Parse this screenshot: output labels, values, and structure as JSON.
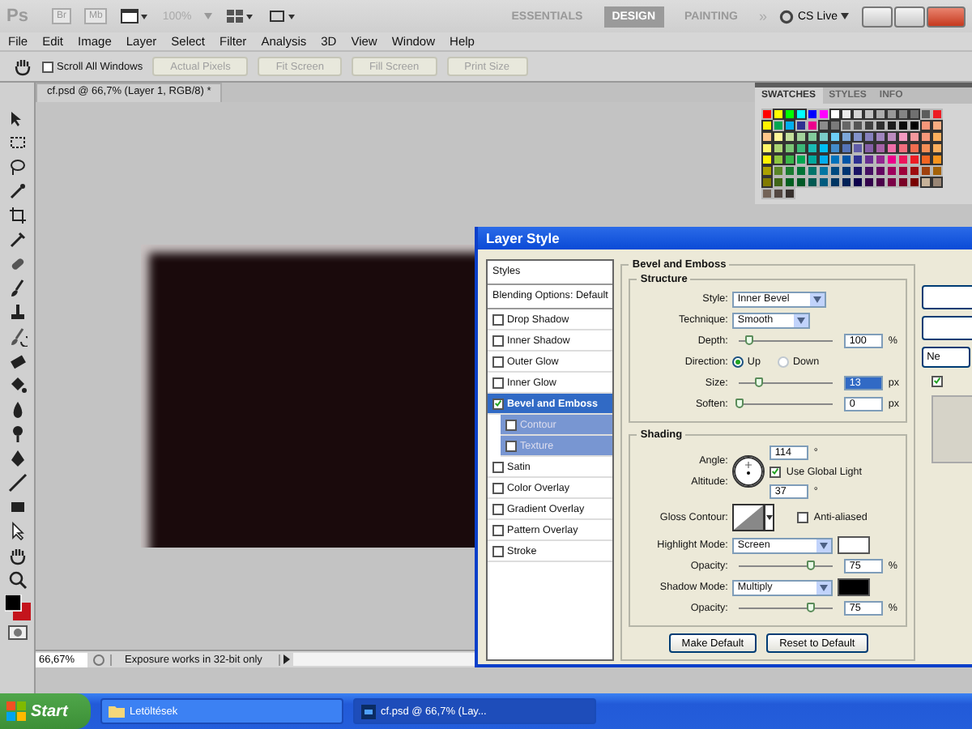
{
  "app_bar": {
    "logo": "Ps",
    "bridge": "Br",
    "mini_bridge": "Mb",
    "zoom_preset": "100%",
    "workspaces": [
      {
        "label": "ESSENTIALS",
        "selected": false
      },
      {
        "label": "DESIGN",
        "selected": true
      },
      {
        "label": "PAINTING",
        "selected": false
      }
    ],
    "more": "»",
    "cs_live": "CS Live"
  },
  "menu": [
    "File",
    "Edit",
    "Image",
    "Layer",
    "Select",
    "Filter",
    "Analysis",
    "3D",
    "View",
    "Window",
    "Help"
  ],
  "options_bar": {
    "scroll_all": {
      "label": "Scroll All Windows",
      "checked": false
    },
    "buttons": [
      {
        "label": "Actual Pixels",
        "disabled": true
      },
      {
        "label": "Fit Screen",
        "disabled": true
      },
      {
        "label": "Fill Screen",
        "disabled": true
      },
      {
        "label": "Print Size",
        "disabled": true
      }
    ]
  },
  "tools": {
    "foreground": {
      "color": "#000000"
    },
    "background": {
      "color": "#c4141c"
    }
  },
  "document": {
    "tab": "cf.psd @ 66,7% (Layer 1, RGB/8) *",
    "zoom": "66,67%",
    "status": "Exposure works in 32-bit only"
  },
  "swatches_panel": {
    "tabs": [
      {
        "label": "SWATCHES",
        "selected": true
      },
      {
        "label": "STYLES",
        "selected": false
      },
      {
        "label": "INFO",
        "selected": false
      }
    ],
    "swatches": [
      [
        {
          "color": "#ff0000"
        },
        {
          "color": "#ffff00"
        },
        {
          "color": "#00ff00"
        },
        {
          "color": "#00ffff"
        },
        {
          "color": "#0000ff"
        },
        {
          "color": "#ff00ff"
        },
        {
          "color": "#ffffff"
        },
        {
          "color": "#ebebeb"
        },
        {
          "color": "#d6d6d6"
        },
        {
          "color": "#c2c2c2"
        },
        {
          "color": "#adadad"
        },
        {
          "color": "#999999"
        },
        {
          "color": "#858585"
        },
        {
          "color": "#707070"
        },
        {
          "color": "#5c5c5c"
        },
        {
          "color": "#ed1c24"
        }
      ],
      [
        {
          "color": "#fff200"
        },
        {
          "color": "#00a651"
        },
        {
          "color": "#00aeef"
        },
        {
          "color": "#2e3192"
        },
        {
          "color": "#ec008c"
        },
        {
          "color": "#8c8c8c"
        },
        {
          "color": "#7a7a7a"
        },
        {
          "color": "#666666"
        },
        {
          "color": "#545454"
        },
        {
          "color": "#404040"
        },
        {
          "color": "#2e2e2e"
        },
        {
          "color": "#1c1c1c"
        },
        {
          "color": "#0a0a0a"
        },
        {
          "color": "#000000"
        },
        {
          "color": "#f69679"
        },
        {
          "color": "#f9ad81"
        }
      ],
      [
        {
          "color": "#fdc68a"
        },
        {
          "color": "#fff799"
        },
        {
          "color": "#c4df9b"
        },
        {
          "color": "#a3d39c"
        },
        {
          "color": "#82ca9c"
        },
        {
          "color": "#7accc8"
        },
        {
          "color": "#6dcff6"
        },
        {
          "color": "#7da7d9"
        },
        {
          "color": "#8393ca"
        },
        {
          "color": "#8781bd"
        },
        {
          "color": "#a186be"
        },
        {
          "color": "#bd8cbf"
        },
        {
          "color": "#f49ac1"
        },
        {
          "color": "#f5989d"
        },
        {
          "color": "#f7977a"
        },
        {
          "color": "#fbaf5d"
        }
      ],
      [
        {
          "color": "#fff568"
        },
        {
          "color": "#acd373"
        },
        {
          "color": "#7cc576"
        },
        {
          "color": "#3bb878"
        },
        {
          "color": "#1abbb4"
        },
        {
          "color": "#00bff3"
        },
        {
          "color": "#438ccb"
        },
        {
          "color": "#5574b9"
        },
        {
          "color": "#605ca8"
        },
        {
          "color": "#855fa8"
        },
        {
          "color": "#a763a8"
        },
        {
          "color": "#f06ea9"
        },
        {
          "color": "#f26d7d"
        },
        {
          "color": "#f26c4f"
        },
        {
          "color": "#f68e56"
        },
        {
          "color": "#fbaf5d"
        }
      ],
      [
        {
          "color": "#fff200"
        },
        {
          "color": "#8dc63f"
        },
        {
          "color": "#39b54a"
        },
        {
          "color": "#00a651"
        },
        {
          "color": "#00a99d"
        },
        {
          "color": "#00aeef"
        },
        {
          "color": "#0072bc"
        },
        {
          "color": "#0054a6"
        },
        {
          "color": "#2e3192"
        },
        {
          "color": "#662d91"
        },
        {
          "color": "#92278f"
        },
        {
          "color": "#ec008c"
        },
        {
          "color": "#ed145b"
        },
        {
          "color": "#ed1c24"
        },
        {
          "color": "#f26522"
        },
        {
          "color": "#f7941d"
        }
      ],
      [
        {
          "color": "#aba000"
        },
        {
          "color": "#598527"
        },
        {
          "color": "#197b30"
        },
        {
          "color": "#007236"
        },
        {
          "color": "#00746b"
        },
        {
          "color": "#0076a3"
        },
        {
          "color": "#004a80"
        },
        {
          "color": "#003471"
        },
        {
          "color": "#1b1464"
        },
        {
          "color": "#440e62"
        },
        {
          "color": "#630460"
        },
        {
          "color": "#9e005d"
        },
        {
          "color": "#9e0039"
        },
        {
          "color": "#9e0b0f"
        },
        {
          "color": "#a0410d"
        },
        {
          "color": "#a36209"
        }
      ],
      [
        {
          "color": "#827b00"
        },
        {
          "color": "#406618"
        },
        {
          "color": "#005e20"
        },
        {
          "color": "#005826"
        },
        {
          "color": "#005952"
        },
        {
          "color": "#005b7f"
        },
        {
          "color": "#003663"
        },
        {
          "color": "#002157"
        },
        {
          "color": "#0d004c"
        },
        {
          "color": "#32004b"
        },
        {
          "color": "#4b0049"
        },
        {
          "color": "#7b0046"
        },
        {
          "color": "#7a0026"
        },
        {
          "color": "#790000"
        },
        {
          "color": "#c7b299"
        },
        {
          "color": "#998675"
        }
      ],
      [
        {
          "color": "#736357"
        },
        {
          "color": "#534741"
        },
        {
          "color": "#37302d"
        }
      ]
    ]
  },
  "layer_style": {
    "title": "Layer Style",
    "styles_header": "Styles",
    "blending": "Blending Options: Default",
    "effects": [
      {
        "label": "Drop Shadow",
        "checked": false,
        "selected": false
      },
      {
        "label": "Inner Shadow",
        "checked": false,
        "selected": false
      },
      {
        "label": "Outer Glow",
        "checked": false,
        "selected": false
      },
      {
        "label": "Inner Glow",
        "checked": false,
        "selected": false
      },
      {
        "label": "Bevel and Emboss",
        "checked": true,
        "selected": true,
        "children": [
          {
            "label": "Contour",
            "checked": false
          },
          {
            "label": "Texture",
            "checked": false
          }
        ]
      },
      {
        "label": "Satin",
        "checked": false,
        "selected": false
      },
      {
        "label": "Color Overlay",
        "checked": false,
        "selected": false
      },
      {
        "label": "Gradient Overlay",
        "checked": false,
        "selected": false
      },
      {
        "label": "Pattern Overlay",
        "checked": false,
        "selected": false
      },
      {
        "label": "Stroke",
        "checked": false,
        "selected": false
      }
    ],
    "bevel_title": "Bevel and Emboss",
    "structure": {
      "title": "Structure",
      "rows": [
        {
          "kind": "select",
          "label": "Style:",
          "value": "Inner Bevel"
        },
        {
          "kind": "select",
          "label": "Technique:",
          "value": "Smooth"
        },
        {
          "kind": "slider",
          "label": "Depth:",
          "level": 0.1,
          "value": "100",
          "unit": "%"
        },
        {
          "kind": "radio",
          "label": "Direction:",
          "options": [
            {
              "label": "Up",
              "selected": true
            },
            {
              "label": "Down",
              "selected": false
            }
          ]
        },
        {
          "kind": "slider",
          "label": "Size:",
          "level": 0.2,
          "value": "13",
          "unit": "px"
        },
        {
          "kind": "slider",
          "label": "Soften:",
          "level": 0,
          "value": "0",
          "unit": "px"
        }
      ]
    },
    "shading": {
      "title": "Shading",
      "angle": {
        "label": "Angle:",
        "value": "114",
        "unit": "°"
      },
      "global_light": {
        "label": "Use Global Light",
        "checked": true
      },
      "altitude": {
        "label": "Altitude:",
        "value": "37",
        "unit": "°"
      },
      "gloss_label": "Gloss Contour:",
      "anti_aliased": {
        "label": "Anti-aliased",
        "checked": false
      },
      "modes": [
        {
          "label": "Highlight Mode:",
          "value": "Screen",
          "color": "#ffffff",
          "opacity_label": "Opacity:",
          "level": 0.75,
          "opacity": "75",
          "unit": "%"
        },
        {
          "label": "Shadow Mode:",
          "value": "Multiply",
          "color": "#000000",
          "opacity_label": "Opacity:",
          "level": 0.75,
          "opacity": "75",
          "unit": "%"
        }
      ]
    },
    "buttons": [
      "Make Default",
      "Reset to Default"
    ],
    "side": {
      "new_style": "Ne",
      "preview_checked": true
    }
  },
  "taskbar": {
    "start": "Start",
    "tasks": [
      {
        "label": "Letöltések",
        "selected": false
      },
      {
        "label": "cf.psd @ 66,7% (Lay...",
        "selected": true
      }
    ]
  }
}
